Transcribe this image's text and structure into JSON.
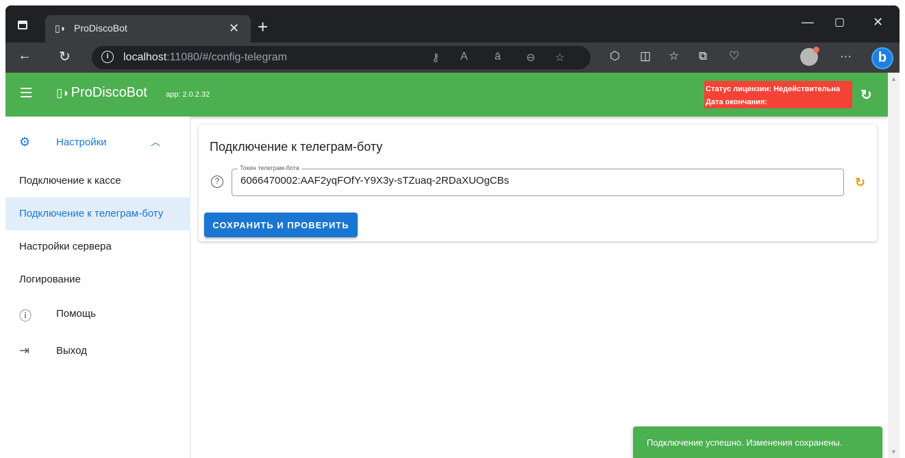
{
  "browser": {
    "tab_title": "ProDiscoBot",
    "url_host": "localhost",
    "url_path": ":11080/#/config-telegram",
    "icons": [
      "window-icon",
      "back-icon",
      "reload-icon",
      "info-icon",
      "key-icon",
      "read-aloud-icon",
      "translate-icon",
      "zoom-out-icon",
      "favorite-icon",
      "extensions-icon",
      "split-screen-icon",
      "favorites-icon",
      "collections-icon",
      "health-icon",
      "profile-avatar",
      "more-icon",
      "bing-icon"
    ]
  },
  "appbar": {
    "brand": "ProDiscoBot",
    "app_version": "app: 2.0.2.32",
    "license_status": "Статус лицензии: Недействительна",
    "license_end": "Дата окончания:"
  },
  "sidebar": {
    "group_label": "Настройки",
    "items": [
      {
        "label": "Подключение к кассе"
      },
      {
        "label": "Подключение к телеграм-боту"
      },
      {
        "label": "Настройки сервера"
      },
      {
        "label": "Логирование"
      },
      {
        "label": "Помощь"
      },
      {
        "label": "Выход"
      }
    ]
  },
  "main": {
    "card_title": "Подключение к телеграм-боту",
    "token_label": "Токен телеграм-бота",
    "token_value": "6066470002:AAF2yqFOfY-Y9X3y-sTZuaq-2RDaXUOgCBs",
    "save_button": "СОХРАНИТЬ И ПРОВЕРИТЬ"
  },
  "toast": {
    "message": "Подключение успешно. Изменения сохранены."
  },
  "colors": {
    "appbar": "#4caf50",
    "license_bg": "#f44336",
    "accent": "#1976d2",
    "reset_icon": "#ef9a1a"
  }
}
